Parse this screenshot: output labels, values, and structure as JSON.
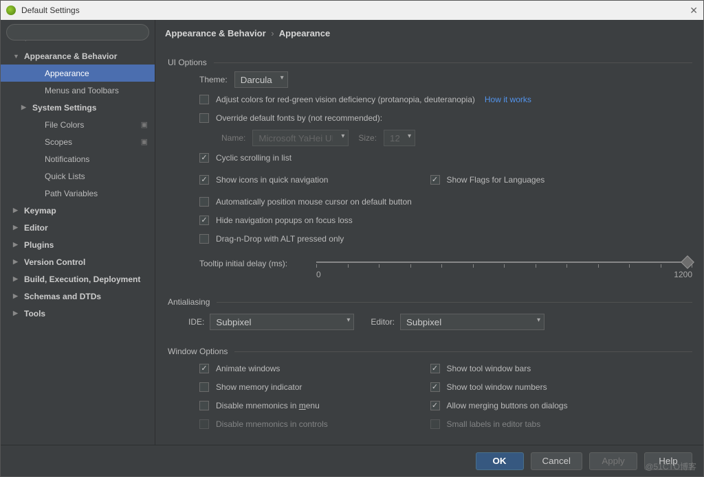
{
  "titlebar": {
    "title": "Default Settings"
  },
  "search": {
    "placeholder": ""
  },
  "sidebar": {
    "items": [
      {
        "label": "Appearance & Behavior",
        "level": 0,
        "expanded": true
      },
      {
        "label": "Appearance",
        "level": 2,
        "selected": true
      },
      {
        "label": "Menus and Toolbars",
        "level": 2
      },
      {
        "label": "System Settings",
        "level": 1,
        "arrow": true
      },
      {
        "label": "File Colors",
        "level": 2,
        "tag": true
      },
      {
        "label": "Scopes",
        "level": 2,
        "tag": true
      },
      {
        "label": "Notifications",
        "level": 2
      },
      {
        "label": "Quick Lists",
        "level": 2
      },
      {
        "label": "Path Variables",
        "level": 2
      },
      {
        "label": "Keymap",
        "level": 0
      },
      {
        "label": "Editor",
        "level": 0,
        "arrow": true
      },
      {
        "label": "Plugins",
        "level": 0
      },
      {
        "label": "Version Control",
        "level": 0,
        "arrow": true
      },
      {
        "label": "Build, Execution, Deployment",
        "level": 0,
        "arrow": true
      },
      {
        "label": "Schemas and DTDs",
        "level": 0,
        "arrow": true
      },
      {
        "label": "Tools",
        "level": 0,
        "arrow": true
      }
    ]
  },
  "breadcrumb": {
    "root": "Appearance & Behavior",
    "leaf": "Appearance"
  },
  "ui_options": {
    "heading": "UI Options",
    "theme_label": "Theme:",
    "theme_value": "Darcula",
    "adjust_colors": {
      "checked": false,
      "label": "Adjust colors for red-green vision deficiency (protanopia, deuteranopia)",
      "link": "How it works"
    },
    "override_fonts": {
      "checked": false,
      "label": "Override default fonts by (not recommended):"
    },
    "font_name_label": "Name:",
    "font_name_value": "Microsoft YaHei UI",
    "font_size_label": "Size:",
    "font_size_value": "12",
    "cyclic": {
      "checked": true,
      "label": "Cyclic scrolling in list"
    },
    "show_icons": {
      "checked": true,
      "label": "Show icons in quick navigation"
    },
    "show_flags": {
      "checked": true,
      "label": "Show Flags for Languages"
    },
    "auto_cursor": {
      "checked": false,
      "label": "Automatically position mouse cursor on default button"
    },
    "hide_nav": {
      "checked": true,
      "label": "Hide navigation popups on focus loss"
    },
    "dnd_alt": {
      "checked": false,
      "label": "Drag-n-Drop with ALT pressed only"
    },
    "tooltip_label": "Tooltip initial delay (ms):",
    "tooltip_min": "0",
    "tooltip_max": "1200"
  },
  "antialiasing": {
    "heading": "Antialiasing",
    "ide_label": "IDE:",
    "ide_value": "Subpixel",
    "editor_label": "Editor:",
    "editor_value": "Subpixel"
  },
  "window_options": {
    "heading": "Window Options",
    "animate": {
      "checked": true,
      "label": "Animate windows"
    },
    "show_bars": {
      "checked": true,
      "label": "Show tool window bars"
    },
    "memory": {
      "checked": false,
      "label": "Show memory indicator"
    },
    "show_numbers": {
      "checked": true,
      "label": "Show tool window numbers"
    },
    "mnemonics_menu": {
      "checked": false,
      "label_pre": "Disable mnemonics in ",
      "label_u": "m",
      "label_post": "enu"
    },
    "allow_merge": {
      "checked": true,
      "label": "Allow merging buttons on dialogs"
    },
    "mnemonics_controls": {
      "checked": false,
      "label": "Disable mnemonics in controls"
    },
    "small_labels": {
      "checked": false,
      "label": "Small labels in editor tabs"
    }
  },
  "footer": {
    "ok": "OK",
    "cancel": "Cancel",
    "apply": "Apply",
    "help": "Help"
  },
  "watermark": "@51CTO博客"
}
